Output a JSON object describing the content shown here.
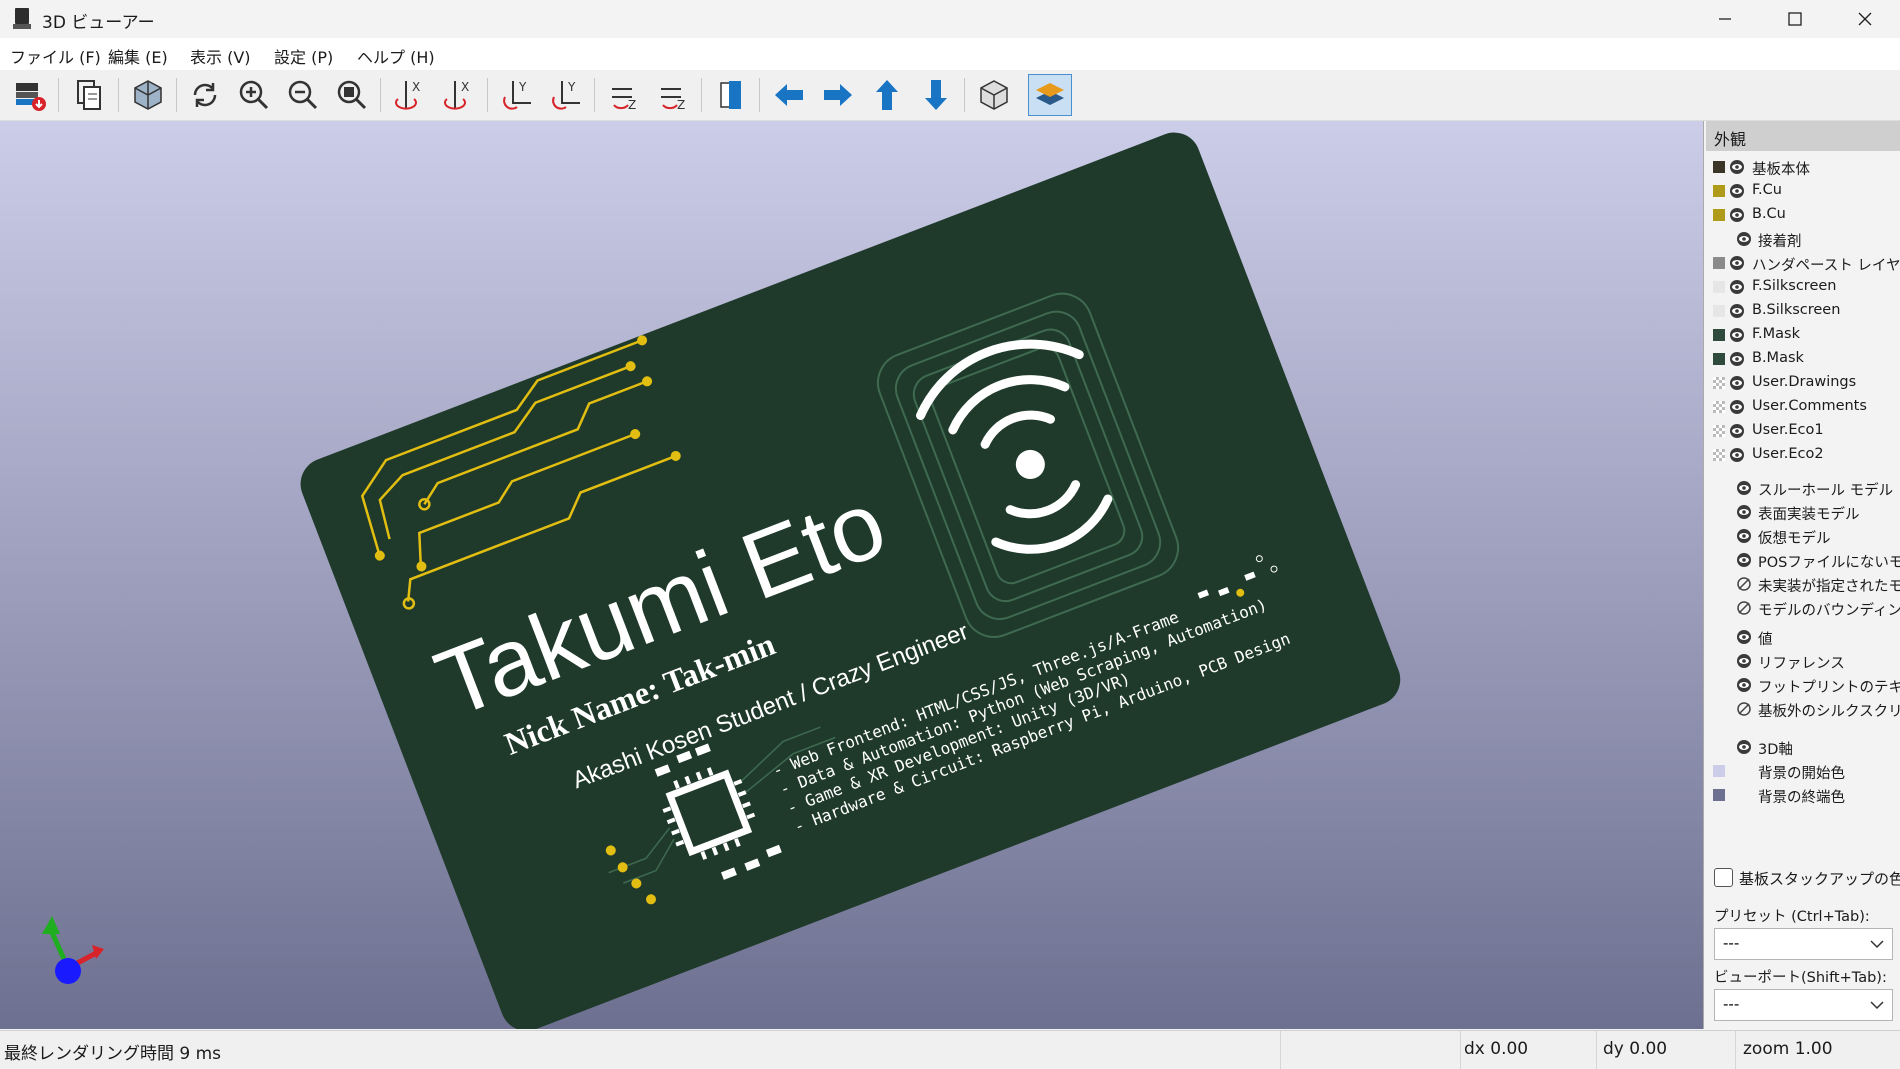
{
  "window": {
    "title": "3D ビューアー"
  },
  "menu": [
    "ファイル (F)",
    "編集 (E)",
    "表示 (V)",
    "設定 (P)",
    "ヘルプ (H)"
  ],
  "board": {
    "name": "Takumi Eto",
    "nickname": "Nick Name: Tak-min",
    "role": "Akashi Kosen Student / Crazy Engineer",
    "skills": [
      "- Web Frontend: HTML/CSS/JS, Three.js/A-Frame",
      "- Data & Automation: Python (Web Scraping, Automation)",
      "- Game & XR Development: Unity (3D/VR)",
      "- Hardware & Circuit: Raspberry Pi, Arduino, PCB Design"
    ]
  },
  "panel": {
    "title": "外観",
    "layers": [
      {
        "label": "基板本体",
        "color": "#3a3526",
        "eye": "visible"
      },
      {
        "label": "F.Cu",
        "color": "#b09a1a",
        "eye": "visible"
      },
      {
        "label": "B.Cu",
        "color": "#b09a1a",
        "eye": "visible"
      },
      {
        "label": "接着剤",
        "color": "",
        "eye": "visible"
      },
      {
        "label": "ハンダペースト レイヤー",
        "color": "#8a8a8a",
        "eye": "visible"
      },
      {
        "label": "F.Silkscreen",
        "color": "#e6e6e6",
        "eye": "visible"
      },
      {
        "label": "B.Silkscreen",
        "color": "#e6e6e6",
        "eye": "visible"
      },
      {
        "label": "F.Mask",
        "color": "#2e4a3c",
        "eye": "visible"
      },
      {
        "label": "B.Mask",
        "color": "#2e4a3c",
        "eye": "visible"
      },
      {
        "label": "User.Drawings",
        "color": "checker",
        "eye": "visible"
      },
      {
        "label": "User.Comments",
        "color": "checker",
        "eye": "visible"
      },
      {
        "label": "User.Eco1",
        "color": "checker",
        "eye": "visible"
      },
      {
        "label": "User.Eco2",
        "color": "checker",
        "eye": "visible"
      }
    ],
    "models": [
      {
        "label": "スルーホール モデル",
        "eye": "visible"
      },
      {
        "label": "表面実装モデル",
        "eye": "visible"
      },
      {
        "label": "仮想モデル",
        "eye": "visible"
      },
      {
        "label": "POSファイルにないモデル",
        "eye": "visible"
      },
      {
        "label": "未実装が指定されたモデル",
        "eye": "hidden"
      },
      {
        "label": "モデルのバウンディングボックス",
        "eye": "hidden"
      }
    ],
    "text_items": [
      {
        "label": "値",
        "eye": "visible"
      },
      {
        "label": "リファレンス",
        "eye": "visible"
      },
      {
        "label": "フットプリントのテキスト",
        "eye": "visible"
      },
      {
        "label": "基板外のシルクスクリーン",
        "eye": "hidden"
      }
    ],
    "axis": {
      "label": "3D軸",
      "eye": "visible"
    },
    "bg": [
      {
        "label": "背景の開始色",
        "color": "#cccde8"
      },
      {
        "label": "背景の終端色",
        "color": "#6d7090"
      }
    ],
    "stackup_checkbox": "基板スタックアップの色を使用",
    "preset_label": "プリセット (Ctrl+Tab):",
    "preset_value": "---",
    "viewport_label": "ビューポート(Shift+Tab):",
    "viewport_value": "---"
  },
  "status": {
    "render": "最終レンダリング時間 9 ms",
    "dx": "dx 0.00",
    "dy": "dy 0.00",
    "zoom": "zoom 1.00"
  },
  "colors": {
    "board": "#1f3a2a",
    "copper": "#e2be12",
    "silk": "#ffffff",
    "accent_blue": "#1a74c4"
  }
}
